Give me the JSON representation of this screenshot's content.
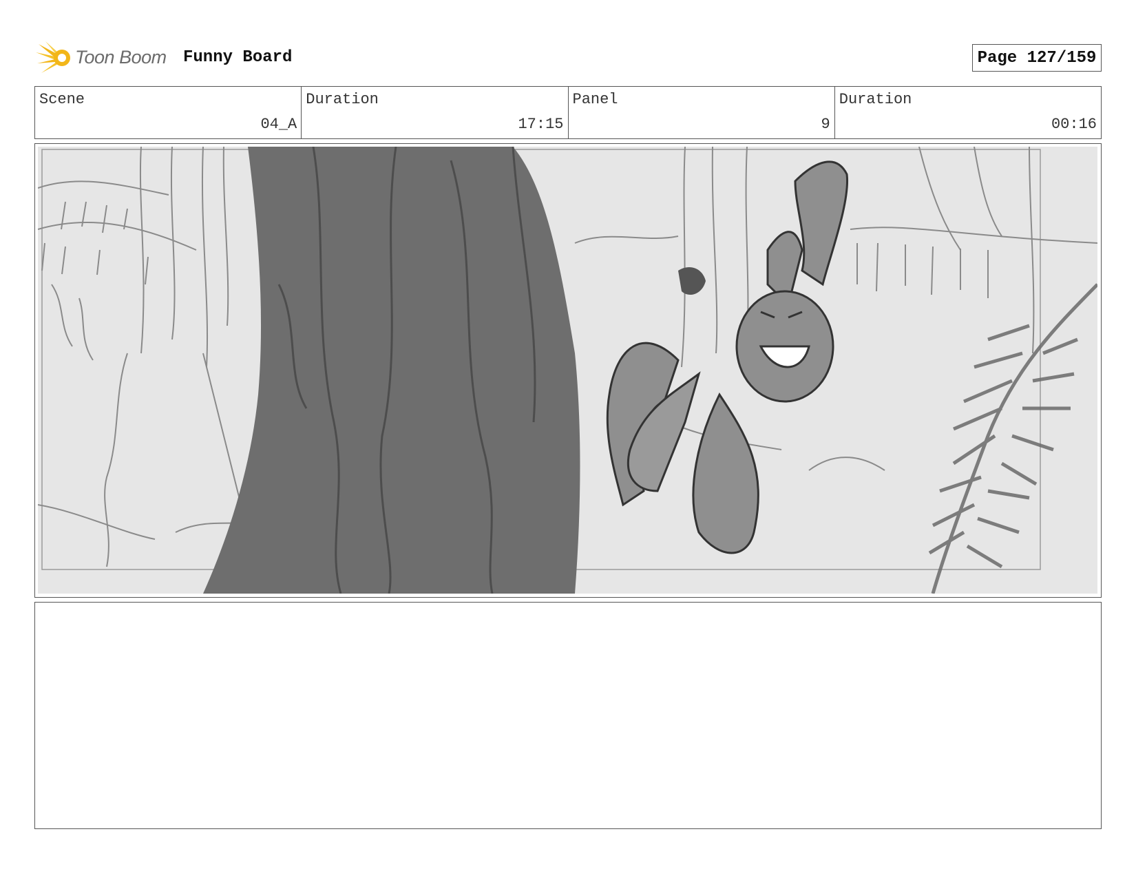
{
  "header": {
    "brand": "Toon Boom",
    "project_title": "Funny Board",
    "page_label": "Page 127/159"
  },
  "info": {
    "scene_label": "Scene",
    "scene_value": "04_A",
    "scene_duration_label": "Duration",
    "scene_duration_value": "17:15",
    "panel_label": "Panel",
    "panel_value": "9",
    "panel_duration_label": "Duration",
    "panel_duration_value": "00:16"
  },
  "notes": {
    "text": ""
  },
  "colors": {
    "logo_accent": "#f2b619",
    "sketch_background": "#e6e6e6",
    "tree_trunk": "#6e6e6e",
    "character": "#8f8f8f",
    "border": "#555555"
  },
  "icons": {
    "logo": "toon-boom-sun-icon"
  }
}
